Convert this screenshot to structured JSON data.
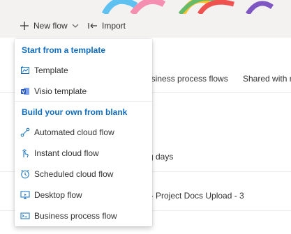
{
  "command_bar": {
    "new_flow_label": "New flow",
    "import_label": "Import"
  },
  "page": {
    "tabs": [
      "usiness process flows",
      "Shared with m"
    ],
    "rows": [
      "g days",
      "l- Project Docs Upload - 3"
    ]
  },
  "menu": {
    "template_header": "Start from a template",
    "template_items": [
      {
        "label": "Template",
        "icon": "template-icon"
      },
      {
        "label": "Visio template",
        "icon": "visio-icon"
      }
    ],
    "blank_header": "Build your own from blank",
    "blank_items": [
      {
        "label": "Automated cloud flow",
        "icon": "automated-flow-icon"
      },
      {
        "label": "Instant cloud flow",
        "icon": "instant-flow-icon"
      },
      {
        "label": "Scheduled cloud flow",
        "icon": "scheduled-flow-icon"
      },
      {
        "label": "Desktop flow",
        "icon": "desktop-flow-icon"
      },
      {
        "label": "Business process flow",
        "icon": "business-process-flow-icon"
      }
    ]
  },
  "colors": {
    "accent": "#0f6cbd",
    "text": "#323130",
    "command_bar_bg": "#f3f2f1"
  }
}
